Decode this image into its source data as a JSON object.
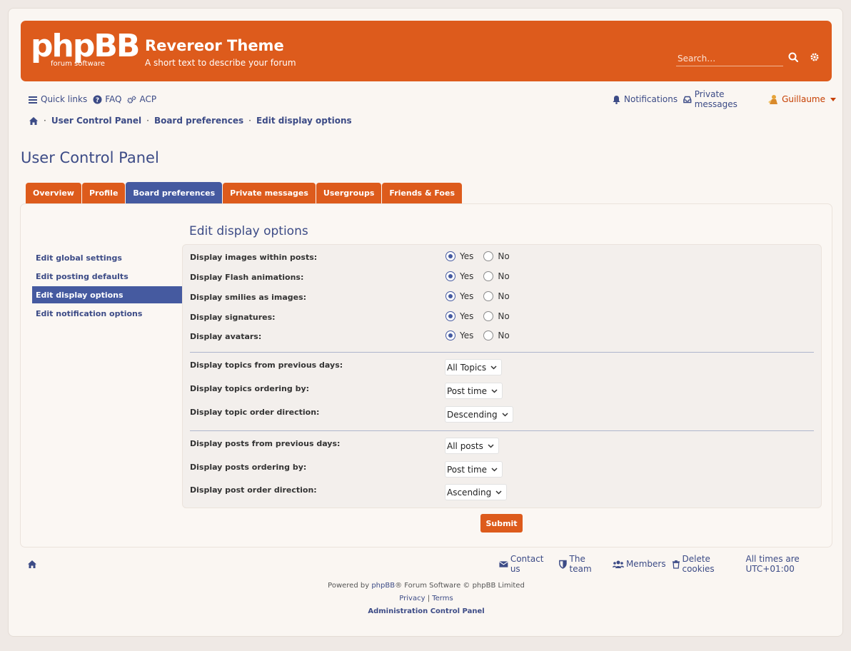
{
  "header": {
    "logo_word": "phpBB",
    "logo_sub": "forum software",
    "title": "Revereor Theme",
    "description": "A short text to describe your forum",
    "search_placeholder": "Search…"
  },
  "navbar": {
    "quick_links": "Quick links",
    "faq": "FAQ",
    "acp": "ACP",
    "notifications": "Notifications",
    "private_messages": "Private messages",
    "username": "Guillaume"
  },
  "breadcrumb": {
    "items": [
      "User Control Panel",
      "Board preferences",
      "Edit display options"
    ]
  },
  "page_title": "User Control Panel",
  "tabs": [
    {
      "label": "Overview",
      "active": false
    },
    {
      "label": "Profile",
      "active": false
    },
    {
      "label": "Board preferences",
      "active": true
    },
    {
      "label": "Private messages",
      "active": false
    },
    {
      "label": "Usergroups",
      "active": false
    },
    {
      "label": "Friends & Foes",
      "active": false
    }
  ],
  "sidemenu": {
    "items": [
      {
        "label": "Edit global settings",
        "active": false
      },
      {
        "label": "Edit posting defaults",
        "active": false
      },
      {
        "label": "Edit display options",
        "active": true
      },
      {
        "label": "Edit notification options",
        "active": false
      }
    ]
  },
  "content": {
    "title": "Edit display options",
    "yes": "Yes",
    "no": "No",
    "radio_rows": [
      {
        "label": "Display images within posts:",
        "value": "Yes"
      },
      {
        "label": "Display Flash animations:",
        "value": "Yes"
      },
      {
        "label": "Display smilies as images:",
        "value": "Yes"
      },
      {
        "label": "Display signatures:",
        "value": "Yes"
      },
      {
        "label": "Display avatars:",
        "value": "Yes"
      }
    ],
    "topic_rows": [
      {
        "label": "Display topics from previous days:",
        "value": "All Topics"
      },
      {
        "label": "Display topics ordering by:",
        "value": "Post time"
      },
      {
        "label": "Display topic order direction:",
        "value": "Descending"
      }
    ],
    "post_rows": [
      {
        "label": "Display posts from previous days:",
        "value": "All posts"
      },
      {
        "label": "Display posts ordering by:",
        "value": "Post time"
      },
      {
        "label": "Display post order direction:",
        "value": "Ascending"
      }
    ],
    "submit_label": "Submit"
  },
  "footer": {
    "contact": "Contact us",
    "team": "The team",
    "members": "Members",
    "delete_cookies": "Delete cookies",
    "timezone": "All times are UTC+01:00",
    "powered_prefix": "Powered by ",
    "powered_link": "phpBB",
    "powered_suffix": "® Forum Software © phpBB Limited",
    "privacy": "Privacy",
    "separator": "|",
    "terms": "Terms",
    "acp_link": "Administration Control Panel"
  },
  "colors": {
    "brand_orange": "#dd5b1c",
    "accent_blue": "#455aa0",
    "link_blue": "#3c4b86",
    "background": "#efe9e5"
  }
}
